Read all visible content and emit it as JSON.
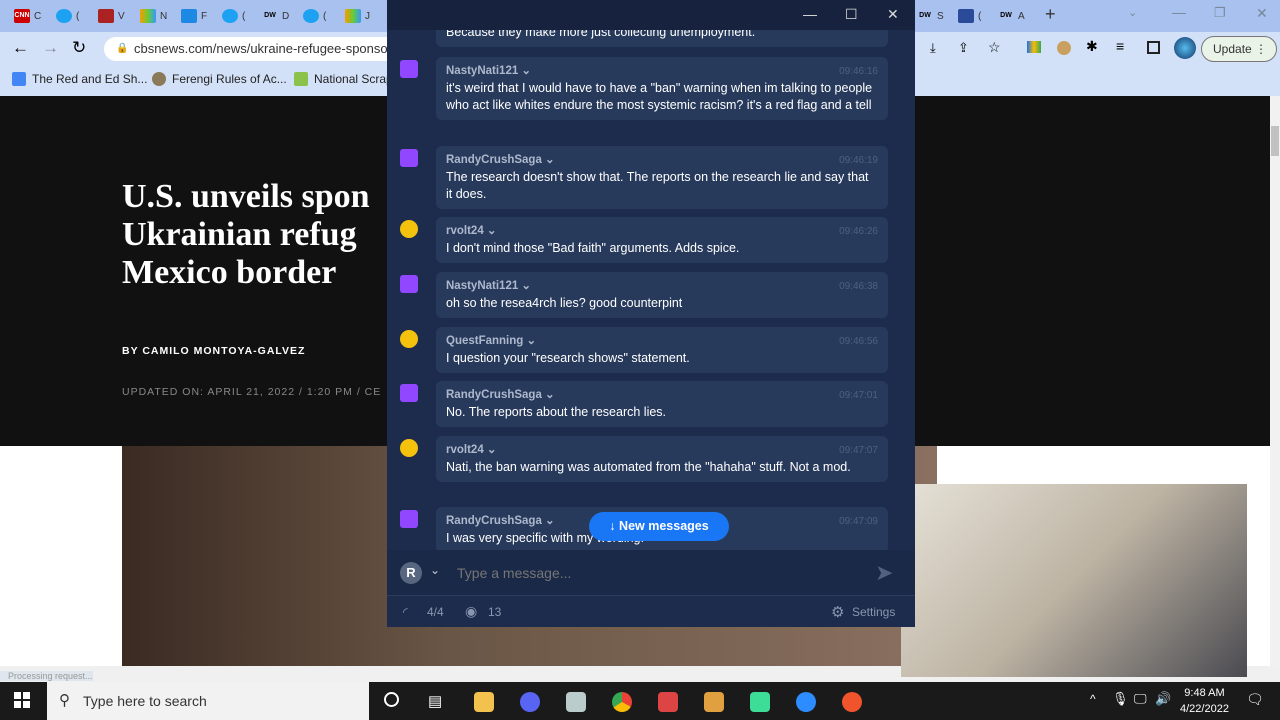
{
  "browser": {
    "tabs": [
      "C",
      "(",
      "V",
      "N",
      "F",
      "(",
      "D",
      "(",
      "J",
      "S",
      "(",
      "A"
    ],
    "url": "cbsnews.com/news/ukraine-refugee-sponso",
    "update_label": "Update",
    "bookmarks": [
      "The Red and Ed Sh...",
      "Ferengi Rules of Ac...",
      "National Scrap"
    ],
    "status": "Processing request..."
  },
  "article": {
    "headline": [
      "U.S. unveils spon",
      "Ukrainian refug",
      "Mexico border"
    ],
    "byline": "BY CAMILO MONTOYA-GALVEZ",
    "updated": "UPDATED ON: APRIL 21, 2022 / 1:20 PM / CE"
  },
  "chat": {
    "messages": [
      {
        "text": "Because they make more just collecting unemployment."
      },
      {
        "user": "NastyNati121",
        "time": "09:46:16",
        "platform": "twitch",
        "text": "it's weird that I would have to have a \"ban\" warning when im talking to people who act like whites endure the most systemic racism? it's a red flag and a tell"
      },
      {
        "user": "RandyCrushSaga",
        "time": "09:46:19",
        "platform": "twitch",
        "text": "The research doesn't show that. The reports on the research lie and say that it does."
      },
      {
        "user": "rvolt24",
        "time": "09:46:26",
        "platform": "rumble",
        "text": "I don't mind those \"Bad faith\" arguments. Adds spice."
      },
      {
        "user": "NastyNati121",
        "time": "09:46:38",
        "platform": "twitch",
        "text": "oh so the resea4rch lies? good counterpint"
      },
      {
        "user": "QuestFanning",
        "time": "09:46:56",
        "platform": "rumble",
        "text": "I question your \"research shows\" statement."
      },
      {
        "user": "RandyCrushSaga",
        "time": "09:47:01",
        "platform": "twitch",
        "text": "No. The reports about the research lies."
      },
      {
        "user": "rvolt24",
        "time": "09:47:07",
        "platform": "rumble",
        "text": "Nati, the ban warning was automated from the \"hahaha\" stuff. Not a mod."
      },
      {
        "user": "RandyCrushSaga",
        "time": "09:47:09",
        "platform": "twitch",
        "text": "I was very specific with my wording."
      }
    ],
    "new_messages": "New messages",
    "avatar_letter": "R",
    "placeholder": "Type a message...",
    "connections": "4/4",
    "viewers": "13",
    "settings": "Settings"
  },
  "taskbar": {
    "search_placeholder": "Type here to search",
    "time": "9:48 AM",
    "date": "4/22/2022"
  }
}
